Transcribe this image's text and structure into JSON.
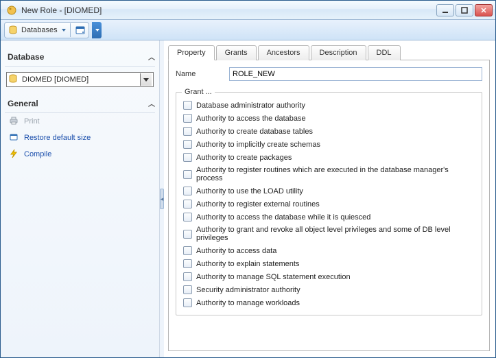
{
  "window": {
    "title": "New Role - [DIOMED]"
  },
  "toolbar": {
    "databases_label": "Databases"
  },
  "sidebar": {
    "database_section": "Database",
    "database_selected": "DIOMED [DIOMED]",
    "general_section": "General",
    "actions": {
      "print": "Print",
      "restore": "Restore default size",
      "compile": "Compile"
    }
  },
  "tabs": [
    "Property",
    "Grants",
    "Ancestors",
    "Description",
    "DDL"
  ],
  "active_tab": 0,
  "form": {
    "name_label": "Name",
    "name_value": "ROLE_NEW",
    "grant_legend": "Grant ...",
    "grants": [
      "Database administrator authority",
      "Authority to access the database",
      "Authority to create database tables",
      "Authority to implicitly create schemas",
      "Authority to create packages",
      "Authority to register routines which are executed in the database manager's process",
      "Authority to use the LOAD utility",
      "Authority to register external routines",
      "Authority to access the database while it is quiesced",
      "Authority to grant and revoke all object level privileges and some of DB level privileges",
      "Authority to access data",
      "Authority to explain statements",
      "Authority to manage SQL statement execution",
      "Security administrator authority",
      "Authority to manage workloads"
    ]
  }
}
